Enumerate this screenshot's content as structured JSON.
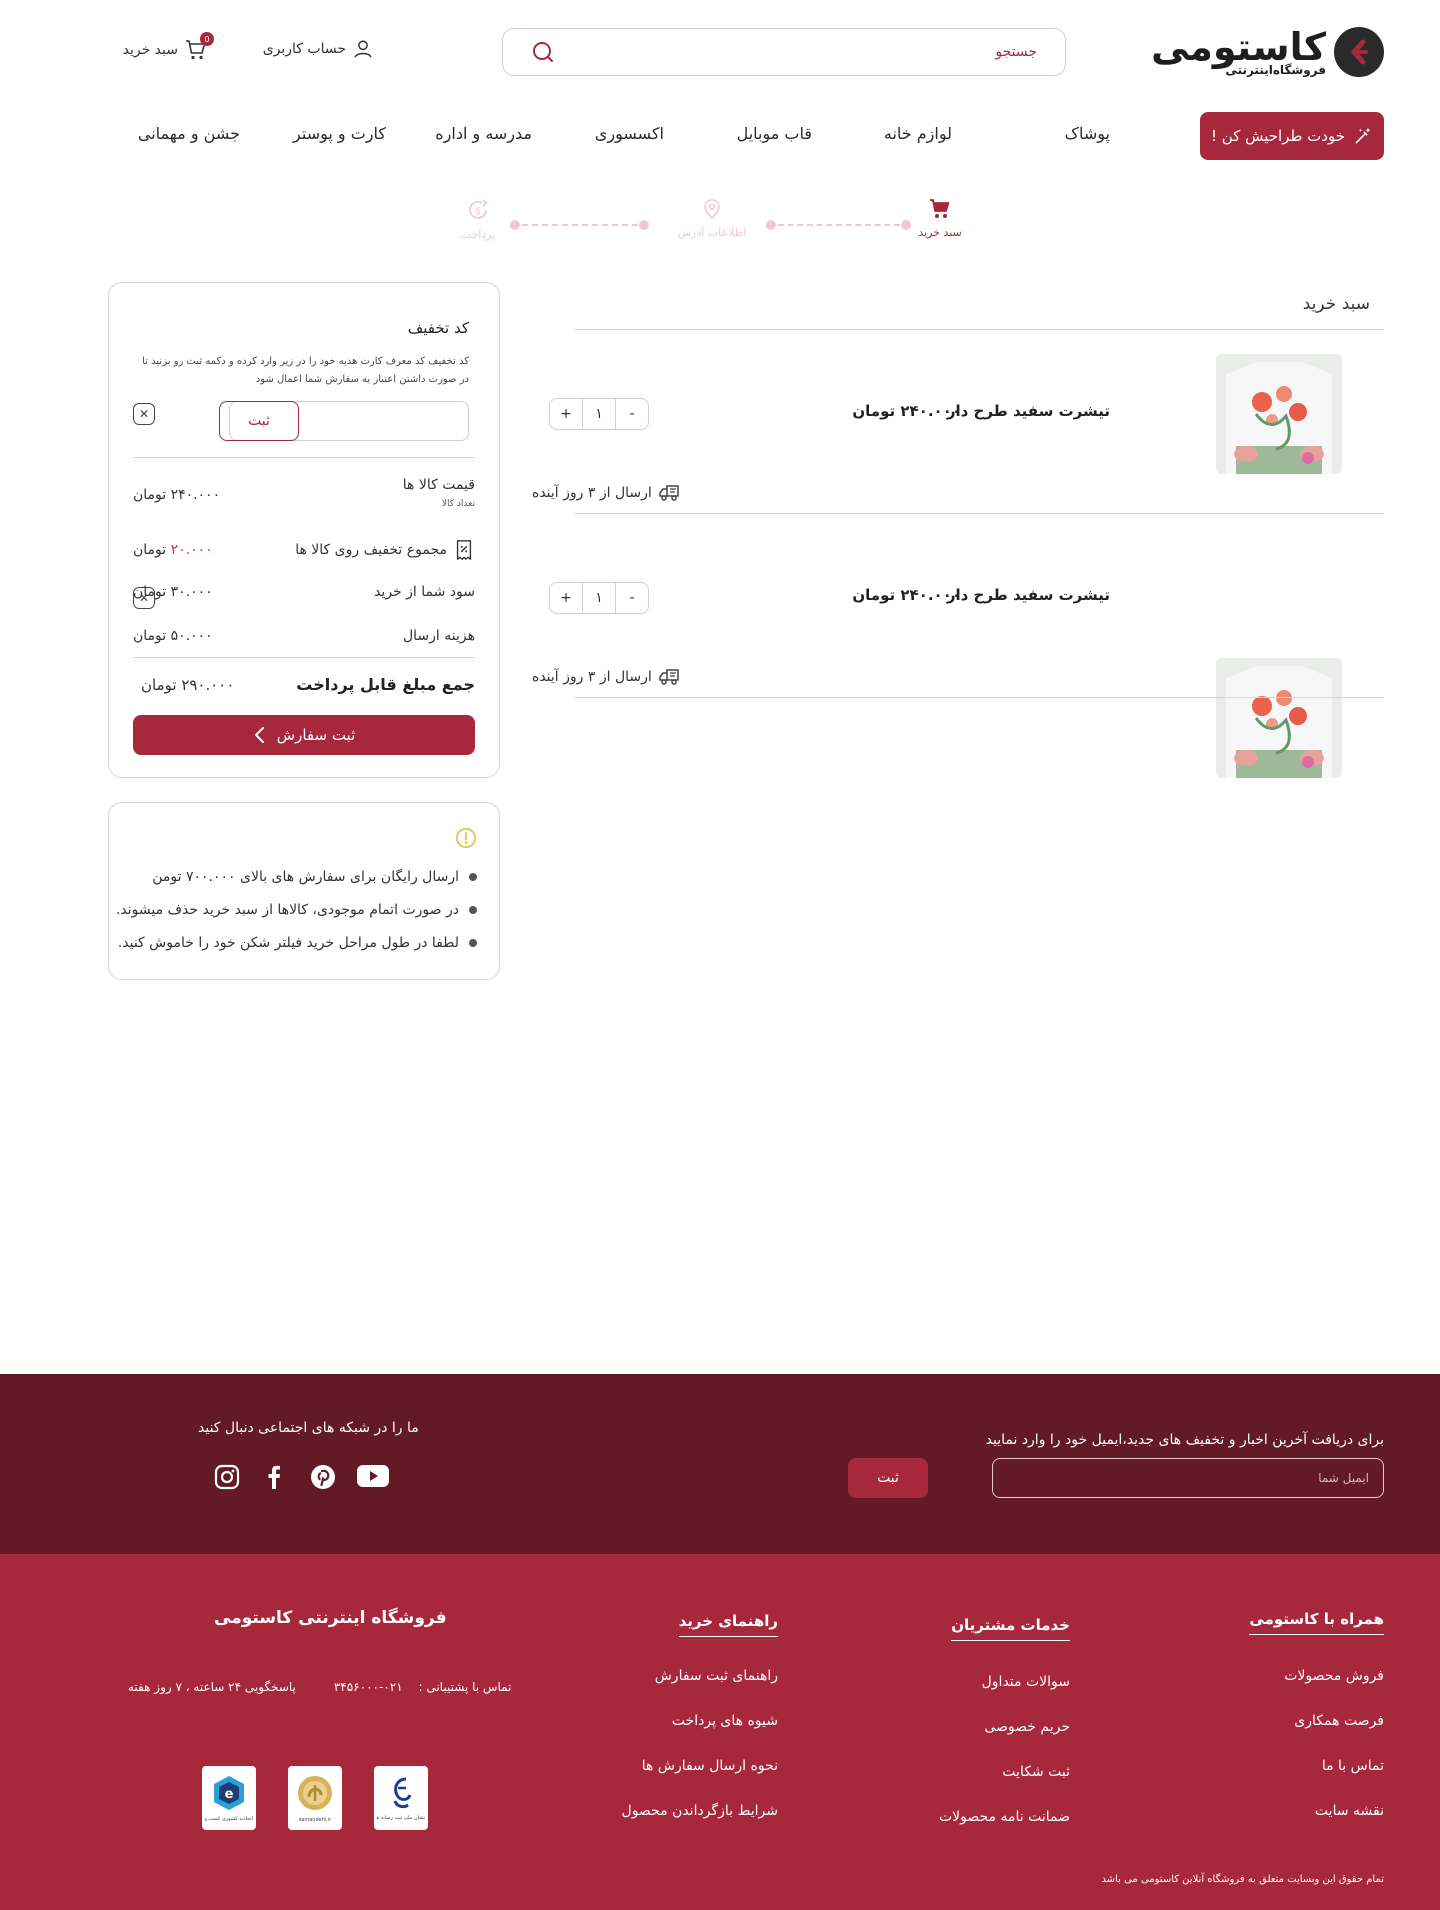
{
  "header": {
    "logo_title": "کاستومی",
    "logo_subtitle": "فروشگاه‌اینترنتی",
    "search_placeholder": "جستجو",
    "account_label": "حساب کاربری",
    "cart_label": "سبد خرید",
    "cart_count": "0"
  },
  "nav": {
    "cta_label": "خودت طراحیش کن !",
    "items": [
      "پوشاک",
      "لوازم خانه",
      "قاب موبایل",
      "اکسسوری",
      "مدرسه و اداره",
      "کارت و پوستر",
      "جشن و مهمانی"
    ]
  },
  "steps": [
    {
      "label": "سبد خرید",
      "state": "active"
    },
    {
      "label": "اطلاعات آدرس",
      "state": "inactive"
    },
    {
      "label": "پرداخت",
      "state": "inactive"
    }
  ],
  "cart": {
    "title": "سبد خرید",
    "items": [
      {
        "name": "تیشرت سفید طرح دار",
        "price": "۲۴۰.۰۰۰ تومان",
        "qty": "۱",
        "shipping": "ارسال از ۳ روز آینده"
      },
      {
        "name": "تیشرت سفید طرح دار",
        "price": "۲۴۰.۰۰۰ تومان",
        "qty": "۱",
        "shipping": "ارسال از ۳ روز آینده"
      }
    ],
    "plus": "+",
    "minus": "-"
  },
  "summary": {
    "coupon_title": "کد تخفیف",
    "coupon_desc": "کد تخفیف کد معرف کارت هدیه خود را در زیر وارد کرده و دکمه ثبت رو بزنید تا در صورت داشتن اعتبار به سفارش شما اعمال شود",
    "coupon_button": "ثبت",
    "items_price_label": "قیمت کالا ها",
    "items_count_label": "تعداد کالا",
    "items_price_value": "۲۴۰.۰۰۰ تومان",
    "discount_label": "مجموع تخفیف روی کالا ها",
    "discount_value_num": "۲۰.۰۰۰",
    "discount_value_unit": "تومان",
    "profit_label": "سود شما از خرید",
    "profit_value": "۳۰.۰۰۰ تومان",
    "shipping_label": "هزینه ارسال",
    "shipping_value": "۵۰.۰۰۰ تومان",
    "total_label": "جمع مبلغ قابل پرداخت",
    "total_value": "۲۹۰.۰۰۰ تومان",
    "order_button": "ثبت سفارش"
  },
  "notes": [
    "ارسال رایگان برای سفارش های بالای ۷۰۰.۰۰۰ تومن",
    "در صورت اتمام موجودی، کالاها از سبد خرید حذف میشوند.",
    "لطفا در طول مراحل خرید فیلتر شکن خود را خاموش کنید."
  ],
  "newsletter": {
    "text": "برای دریافت آخرین اخبار و تخفیف های جدید،ایمیل خود را وارد نمایید",
    "placeholder": "ایمیل شما",
    "button": "ثبت",
    "social_text": "ما را در شبکه های اجتماعی دنبال کنید"
  },
  "footer": {
    "col1_title": "همراه با کاستومی",
    "col1_links": [
      "فروش محصولات",
      "فرصت همکاری",
      "تماس با ما",
      "نقشه سایت"
    ],
    "col2_title": "خدمات مشتریان",
    "col2_links": [
      "سوالات متداول",
      "حریم خصوصی",
      "ثبت شکایت",
      "ضمانت نامه  محصولات"
    ],
    "col3_title": "راهنمای خرید",
    "col3_links": [
      "راهنمای ثبت سفارش",
      "شیوه های پرداخت",
      "نحوه ارسال سفارش ها",
      "شرایط بازگرداندن محصول"
    ],
    "shop_title": "فروشگاه اینترنتی کاستومی",
    "support_label": "تماس با پشتیبانی :",
    "support_phone": "۰۲۱-۳۴۵۶۰۰۰",
    "hours": "پاسخگویی ۲۴ ساعته ، ۷ روز هفته",
    "badge_caps": [
      "نشان ملی ثبت رسانه های دیجیتال",
      "samandehi.ir",
      "اتحادیه کشوری کسب و کارهای مجازی"
    ],
    "copyright": "تمام حقوق این وبسایت متعلق به فروشگاه آنلاین کاستومی می باشد"
  },
  "colors": {
    "primary": "#a8283b",
    "newsletter_bg": "#621a24",
    "step_inactive": "#f0c9cf"
  }
}
